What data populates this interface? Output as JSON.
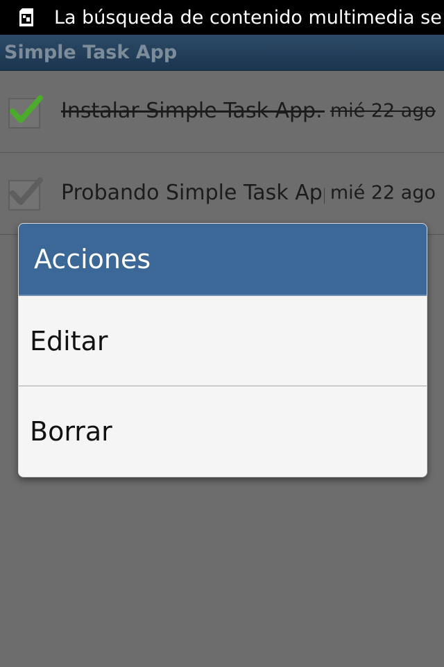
{
  "status_bar": {
    "notification_icon": "sd-card-icon",
    "text": "La búsqueda de contenido multimedia se"
  },
  "app": {
    "title": "Simple Task App"
  },
  "tasks": [
    {
      "title": "Instalar Simple Task App...",
      "date": "mié 22 ago",
      "done": true
    },
    {
      "title": "Probando Simple Task App",
      "date": "mié 22 ago",
      "done": false
    }
  ],
  "dialog": {
    "title": "Acciones",
    "items": [
      {
        "label": "Editar"
      },
      {
        "label": "Borrar"
      }
    ]
  },
  "colors": {
    "accent": "#3b6897",
    "check_green": "#4caa2c",
    "background": "#6d6d6d"
  }
}
